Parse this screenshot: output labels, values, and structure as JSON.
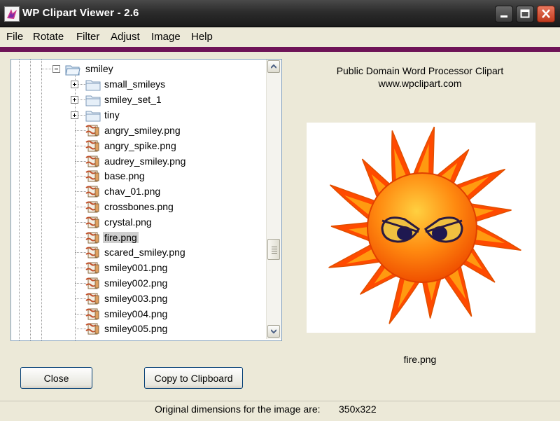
{
  "window": {
    "title": "WP Clipart Viewer - 2.6"
  },
  "menu": [
    "File",
    "Rotate",
    "Filter",
    "Adjust",
    "Image",
    "Help"
  ],
  "tree": {
    "parent_folder": "smiley",
    "subfolders": [
      "small_smileys",
      "smiley_set_1",
      "tiny"
    ],
    "files": [
      "angry_smiley.png",
      "angry_spike.png",
      "audrey_smiley.png",
      "base.png",
      "chav_01.png",
      "crossbones.png",
      "crystal.png",
      "fire.png",
      "scared_smiley.png",
      "smiley001.png",
      "smiley002.png",
      "smiley003.png",
      "smiley004.png",
      "smiley005.png"
    ],
    "selected_file": "fire.png"
  },
  "preview": {
    "caption_line1": "Public Domain Word Processor Clipart",
    "caption_line2": "www.wpclipart.com",
    "filename": "fire.png"
  },
  "buttons": {
    "close": "Close",
    "copy": "Copy to Clipboard"
  },
  "status": {
    "label": "Original  dimensions for the image are:",
    "value": "350x322"
  },
  "colors": {
    "accent_strip": "#6e1357",
    "title_bar": "#2c2c2c",
    "sun_outer": "#ff4a00",
    "sun_inner": "#ff9a10"
  },
  "icons": {
    "app": "clipart-app-icon",
    "folder": "folder-icon",
    "file": "image-file-icon"
  }
}
